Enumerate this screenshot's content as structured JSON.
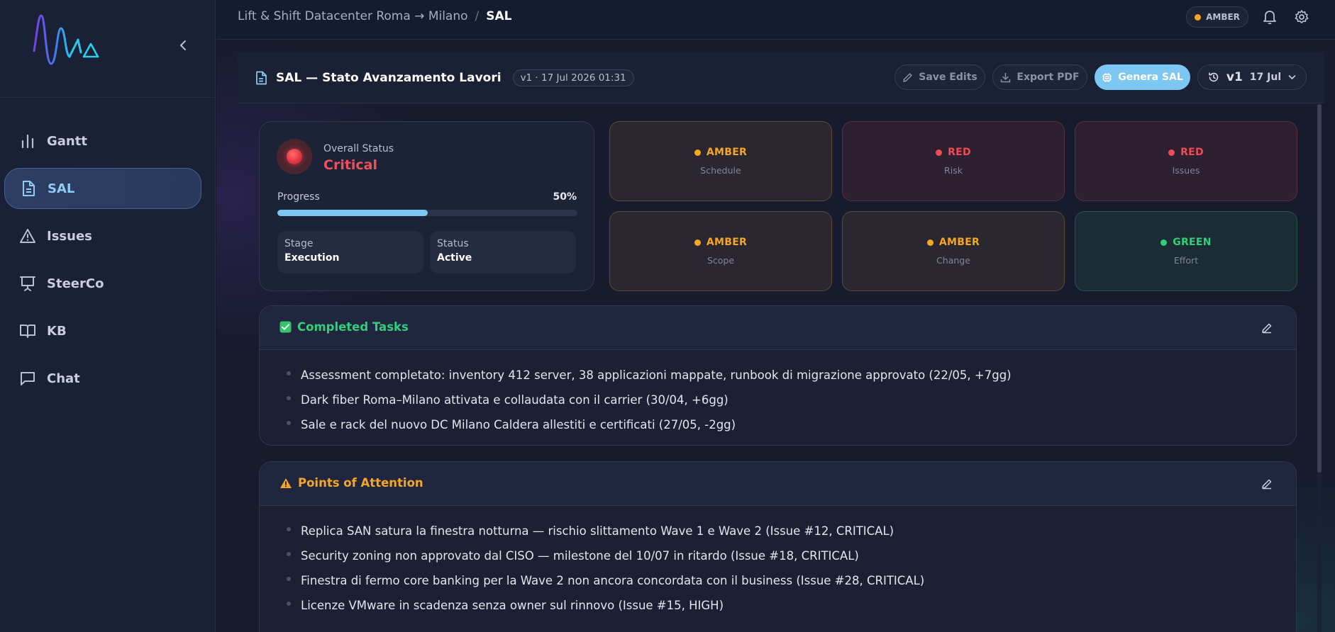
{
  "sidebar": {
    "items": [
      {
        "label": "Gantt"
      },
      {
        "label": "SAL"
      },
      {
        "label": "Issues"
      },
      {
        "label": "SteerCo"
      },
      {
        "label": "KB"
      },
      {
        "label": "Chat"
      }
    ],
    "active": "SAL"
  },
  "topbar": {
    "breadcrumb_project": "Lift & Shift Datacenter Roma → Milano",
    "breadcrumb_sep": "/",
    "breadcrumb_page": "SAL",
    "status": "AMBER"
  },
  "header": {
    "title": "SAL — Stato Avanzamento Lavori",
    "version_badge": "v1 · 17 Jul 2026 01:31",
    "save_label": "Save Edits",
    "export_label": "Export PDF",
    "generate_label": "Genera SAL",
    "version": "v1",
    "version_date": "17 Jul"
  },
  "overall": {
    "label": "Overall Status",
    "value": "Critical",
    "progress_label": "Progress",
    "progress_text": "50%",
    "progress": 0.5,
    "stage_label": "Stage",
    "stage_value": "Execution",
    "status_label": "Status",
    "status_value": "Active"
  },
  "rag": [
    {
      "status": "AMBER",
      "label": "Schedule"
    },
    {
      "status": "RED",
      "label": "Risk"
    },
    {
      "status": "RED",
      "label": "Issues"
    },
    {
      "status": "AMBER",
      "label": "Scope"
    },
    {
      "status": "AMBER",
      "label": "Change"
    },
    {
      "status": "GREEN",
      "label": "Effort"
    }
  ],
  "completed": {
    "title": "Completed Tasks",
    "items": [
      "Assessment completato: inventory 412 server, 38 applicazioni mappate, runbook di migrazione approvato (22/05, +7gg)",
      "Dark fiber Roma–Milano attivata e collaudata con il carrier (30/04, +6gg)",
      "Sale e rack del nuovo DC Milano Caldera allestiti e certificati (27/05, -2gg)"
    ]
  },
  "attention": {
    "title": "Points of Attention",
    "items": [
      "Replica SAN satura la finestra notturna — rischio slittamento Wave 1 e Wave 2 (Issue #12, CRITICAL)",
      "Security zoning non approvato dal CISO — milestone del 10/07 in ritardo (Issue #18, CRITICAL)",
      "Finestra di fermo core banking per la Wave 2 non ancora concordata con il business (Issue #28, CRITICAL)",
      "Licenze VMware in scadenza senza owner sul rinnovo (Issue #15, HIGH)"
    ]
  },
  "colors": {
    "amber": "#f5a623",
    "red": "#f04b55",
    "green": "#2fd07a",
    "accent": "#7cc8f2"
  }
}
